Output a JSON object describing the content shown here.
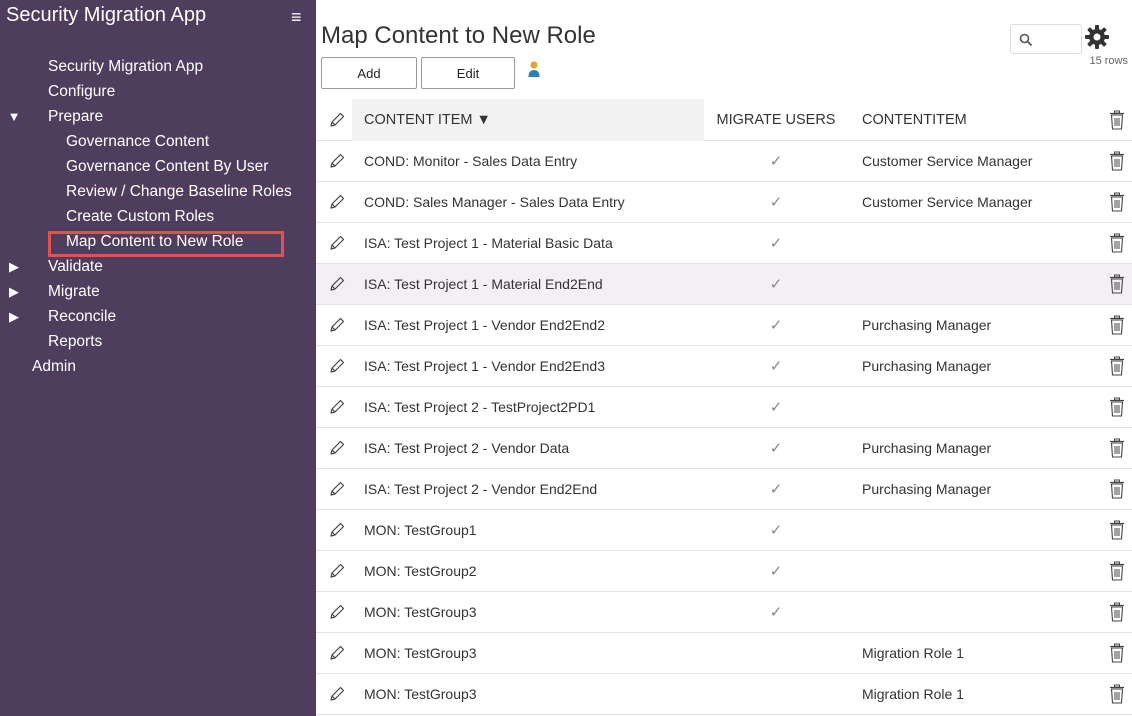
{
  "sidebar": {
    "app_title": "Security Migration App",
    "menu_icon": "hamburger-icon",
    "nav": {
      "app": "Security Migration App",
      "configure": "Configure",
      "prepare": "Prepare",
      "prepare_children": [
        "Governance Content",
        "Governance Content By User",
        "Review / Change Baseline Roles",
        "Create Custom Roles",
        "Map Content to New Role"
      ],
      "validate": "Validate",
      "migrate": "Migrate",
      "reconcile": "Reconcile",
      "reports": "Reports",
      "admin": "Admin"
    },
    "active_item": "Map Content to New Role",
    "background": "#4e3d5c",
    "highlight_color": "#e05252"
  },
  "main": {
    "title": "Map Content to New Role",
    "toolbar": {
      "add_label": "Add",
      "edit_label": "Edit"
    },
    "row_count": "15 rows",
    "columns": [
      "CONTENT ITEM ▼",
      "MIGRATE USERS",
      "CONTENTITEM"
    ],
    "rows": [
      {
        "item": "COND: Monitor - Sales Data Entry",
        "migrate": "✓",
        "role": "Customer Service Manager"
      },
      {
        "item": "COND: Sales Manager - Sales Data Entry",
        "migrate": "✓",
        "role": "Customer Service Manager"
      },
      {
        "item": "ISA: Test Project 1 - Material Basic Data",
        "migrate": "✓",
        "role": ""
      },
      {
        "item": "ISA: Test Project 1 - Material End2End",
        "migrate": "✓",
        "role": ""
      },
      {
        "item": "ISA: Test Project 1 - Vendor End2End2",
        "migrate": "✓",
        "role": "Purchasing Manager"
      },
      {
        "item": "ISA: Test Project 1 - Vendor End2End3",
        "migrate": "✓",
        "role": "Purchasing Manager"
      },
      {
        "item": "ISA: Test Project 2 - TestProject2PD1",
        "migrate": "✓",
        "role": ""
      },
      {
        "item": "ISA: Test Project 2 - Vendor Data",
        "migrate": "✓",
        "role": "Purchasing Manager"
      },
      {
        "item": "ISA: Test Project 2 - Vendor End2End",
        "migrate": "✓",
        "role": "Purchasing Manager"
      },
      {
        "item": "MON: TestGroup1",
        "migrate": "✓",
        "role": ""
      },
      {
        "item": "MON: TestGroup2",
        "migrate": "✓",
        "role": ""
      },
      {
        "item": "MON: TestGroup3",
        "migrate": "✓",
        "role": ""
      },
      {
        "item": "MON: TestGroup3",
        "migrate": "",
        "role": "Migration Role 1"
      },
      {
        "item": "MON: TestGroup3",
        "migrate": "",
        "role": "Migration Role 1"
      }
    ]
  }
}
